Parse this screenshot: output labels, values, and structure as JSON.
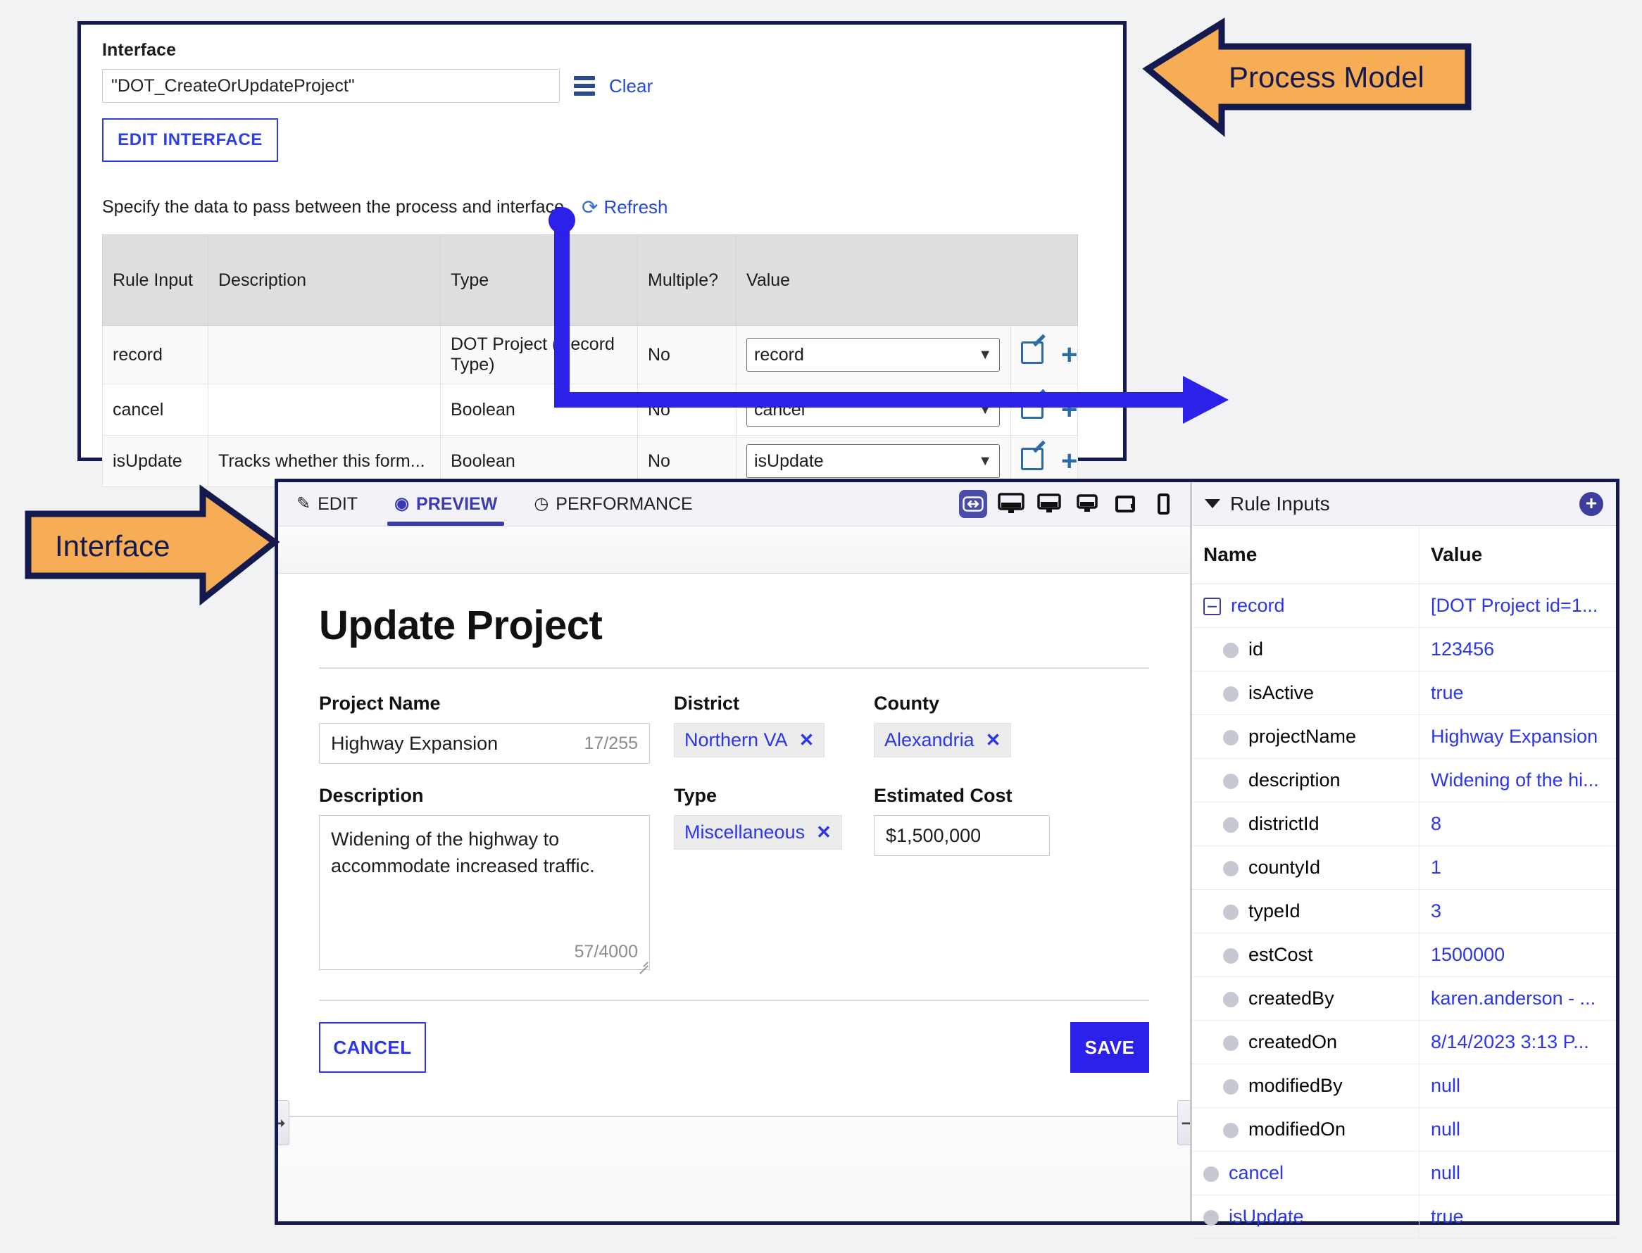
{
  "callouts": {
    "process_model": "Process Model",
    "interface": "Interface"
  },
  "process_model": {
    "interface_label": "Interface",
    "interface_value": "\"DOT_CreateOrUpdateProject\"",
    "clear_link": "Clear",
    "edit_interface_button": "EDIT INTERFACE",
    "specify_text": "Specify the data to pass between the process and interface",
    "refresh_link": "Refresh",
    "table": {
      "headers": [
        "Rule Input",
        "Description",
        "Type",
        "Multiple?",
        "Value",
        ""
      ],
      "rows": [
        {
          "rule_input": "record",
          "description": "",
          "type": "DOT Project (Record Type)",
          "multiple": "No",
          "value": "record"
        },
        {
          "rule_input": "cancel",
          "description": "",
          "type": "Boolean",
          "multiple": "No",
          "value": "cancel"
        },
        {
          "rule_input": "isUpdate",
          "description": "Tracks whether this form...",
          "type": "Boolean",
          "multiple": "No",
          "value": "isUpdate"
        }
      ]
    }
  },
  "interface": {
    "tabs": [
      {
        "label": "EDIT",
        "icon": "edit-pencil-icon",
        "active": false
      },
      {
        "label": "PREVIEW",
        "icon": "eye-icon",
        "active": true
      },
      {
        "label": "PERFORMANCE",
        "icon": "clock-icon",
        "active": false
      }
    ],
    "devices": [
      "responsive-icon",
      "desktop-large-icon",
      "desktop-medium-icon",
      "desktop-small-icon",
      "tablet-icon",
      "phone-icon"
    ],
    "form": {
      "title": "Update Project",
      "project_name_label": "Project Name",
      "project_name_value": "Highway Expansion",
      "project_name_counter": "17/255",
      "district_label": "District",
      "district_value": "Northern VA",
      "county_label": "County",
      "county_value": "Alexandria",
      "description_label": "Description",
      "description_value": "Widening of the highway to accommodate increased traffic.",
      "description_counter": "57/4000",
      "type_label": "Type",
      "type_value": "Miscellaneous",
      "estimated_cost_label": "Estimated Cost",
      "estimated_cost_value": "$1,500,000",
      "cancel_button": "CANCEL",
      "save_button": "SAVE"
    }
  },
  "rule_inputs": {
    "panel_title": "Rule Inputs",
    "headers": {
      "name": "Name",
      "value": "Value"
    },
    "rows": [
      {
        "name": "record",
        "value": "[DOT Project id=1...",
        "level": 0,
        "marker": "minus"
      },
      {
        "name": "id",
        "value": "123456",
        "level": 1,
        "marker": "bullet"
      },
      {
        "name": "isActive",
        "value": "true",
        "level": 1,
        "marker": "bullet"
      },
      {
        "name": "projectName",
        "value": "Highway Expansion",
        "level": 1,
        "marker": "bullet"
      },
      {
        "name": "description",
        "value": "Widening of the hi...",
        "level": 1,
        "marker": "bullet"
      },
      {
        "name": "districtId",
        "value": "8",
        "level": 1,
        "marker": "bullet"
      },
      {
        "name": "countyId",
        "value": "1",
        "level": 1,
        "marker": "bullet"
      },
      {
        "name": "typeId",
        "value": "3",
        "level": 1,
        "marker": "bullet"
      },
      {
        "name": "estCost",
        "value": "1500000",
        "level": 1,
        "marker": "bullet"
      },
      {
        "name": "createdBy",
        "value": "karen.anderson - ...",
        "level": 1,
        "marker": "bullet"
      },
      {
        "name": "createdOn",
        "value": "8/14/2023 3:13 P...",
        "level": 1,
        "marker": "bullet"
      },
      {
        "name": "modifiedBy",
        "value": "null",
        "level": 1,
        "marker": "bullet"
      },
      {
        "name": "modifiedOn",
        "value": "null",
        "level": 1,
        "marker": "bullet"
      },
      {
        "name": "cancel",
        "value": "null",
        "level": 0,
        "marker": "bullet"
      },
      {
        "name": "isUpdate",
        "value": "true",
        "level": 0,
        "marker": "bullet"
      }
    ]
  },
  "colors": {
    "annotation_border": "#141a4e",
    "annotation_fill": "#f7ac56",
    "connector": "#2b21e8",
    "link": "#2349d6",
    "accent_purple": "#3d3d9e",
    "primary_blue": "#2b21e8"
  }
}
